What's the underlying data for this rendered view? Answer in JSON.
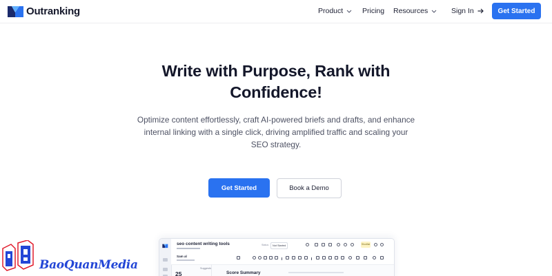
{
  "nav": {
    "logo_text": "Outranking",
    "items": [
      {
        "label": "Product",
        "has_dropdown": true
      },
      {
        "label": "Pricing",
        "has_dropdown": false
      },
      {
        "label": "Resources",
        "has_dropdown": true
      }
    ],
    "sign_in": "Sign In",
    "cta": "Get Started"
  },
  "hero": {
    "title_line1": "Write with Purpose, Rank with",
    "title_line2": "Confidence!",
    "subtitle": "Optimize content effortlessly, craft AI-powered briefs and drafts, and enhance internal linking with a single click, driving amplified traffic and scaling your SEO strategy.",
    "primary_button": "Get Started",
    "secondary_button": "Book a Demo"
  },
  "preview": {
    "doc_title": "seo content writing tools",
    "status_label": "Status",
    "status_value": "Not Started",
    "badge": "Shortlist",
    "user_name": "Sam al",
    "score": "25",
    "score_label": "Suggestio",
    "summary_title": "Score Summary"
  },
  "watermark": {
    "text": "BaoQuanMedia"
  },
  "colors": {
    "accent": "#2a72f0",
    "title": "#14172a",
    "body_text": "#4d5163",
    "watermark": "#2346d6"
  }
}
